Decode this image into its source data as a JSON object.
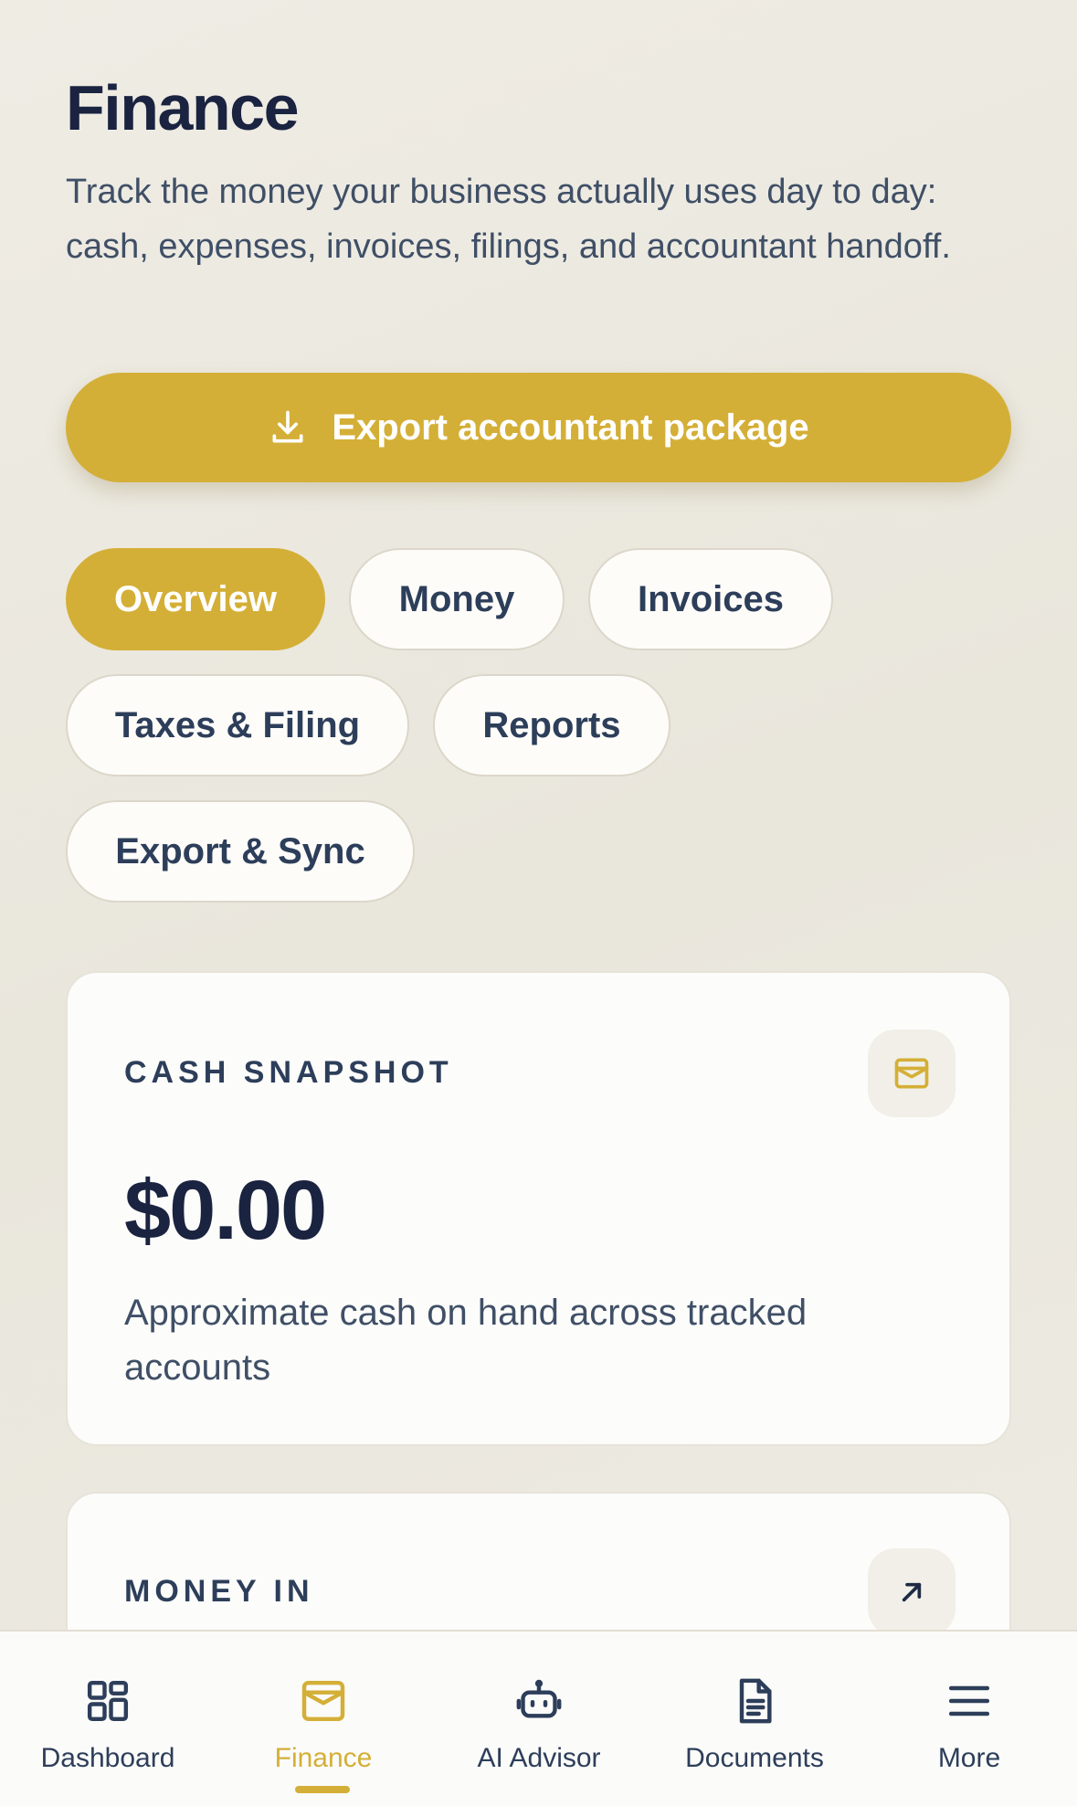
{
  "header": {
    "title": "Finance",
    "subtitle": "Track the money your business actually uses day to day: cash, expenses, invoices, filings, and accountant handoff."
  },
  "export_button": {
    "label": "Export accountant package",
    "icon": "download-icon"
  },
  "tabs": [
    {
      "label": "Overview",
      "active": true
    },
    {
      "label": "Money",
      "active": false
    },
    {
      "label": "Invoices",
      "active": false
    },
    {
      "label": "Taxes & Filing",
      "active": false
    },
    {
      "label": "Reports",
      "active": false
    },
    {
      "label": "Export & Sync",
      "active": false
    }
  ],
  "cards": [
    {
      "label": "CASH SNAPSHOT",
      "value": "$0.00",
      "description": "Approximate cash on hand across tracked accounts",
      "icon": "wallet-icon"
    },
    {
      "label": "MONEY IN",
      "icon": "arrow-up-right-icon"
    }
  ],
  "bottom_nav": [
    {
      "label": "Dashboard",
      "icon": "grid-icon",
      "active": false
    },
    {
      "label": "Finance",
      "icon": "wallet-icon",
      "active": true
    },
    {
      "label": "AI Advisor",
      "icon": "robot-icon",
      "active": false
    },
    {
      "label": "Documents",
      "icon": "document-icon",
      "active": false
    },
    {
      "label": "More",
      "icon": "menu-icon",
      "active": false
    }
  ],
  "colors": {
    "accent": "#d4af37",
    "text_primary": "#1a2340",
    "text_secondary": "#3f4f66",
    "background": "#ece9e1"
  }
}
